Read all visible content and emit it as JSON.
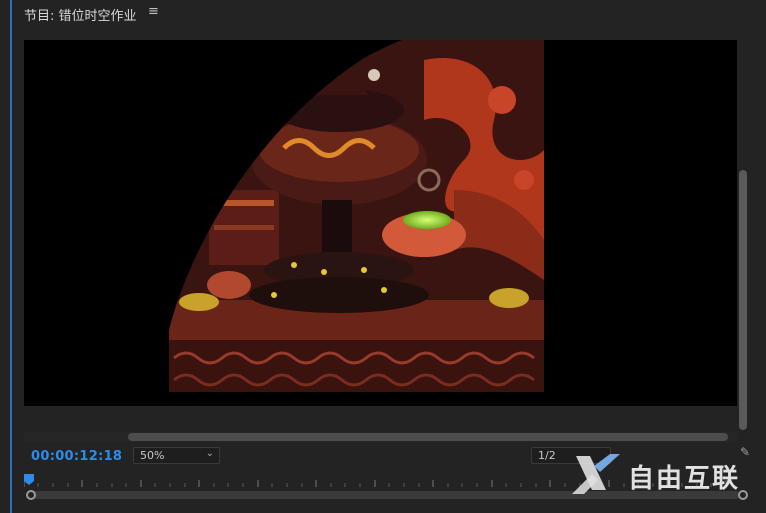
{
  "panel": {
    "title": "节目: 错位时空作业",
    "menu_icon": "hamburger-menu-icon"
  },
  "controls": {
    "timecode": "00:00:12:18",
    "zoom_value": "50%",
    "resolution_value": "1/2",
    "wrench_icon": "wrench-icon"
  },
  "watermark": {
    "text": "自由互联",
    "logo": "x-logo"
  },
  "colors": {
    "accent": "#2d8ceb",
    "panel_bg": "#232323",
    "viewer_bg": "#000000"
  }
}
